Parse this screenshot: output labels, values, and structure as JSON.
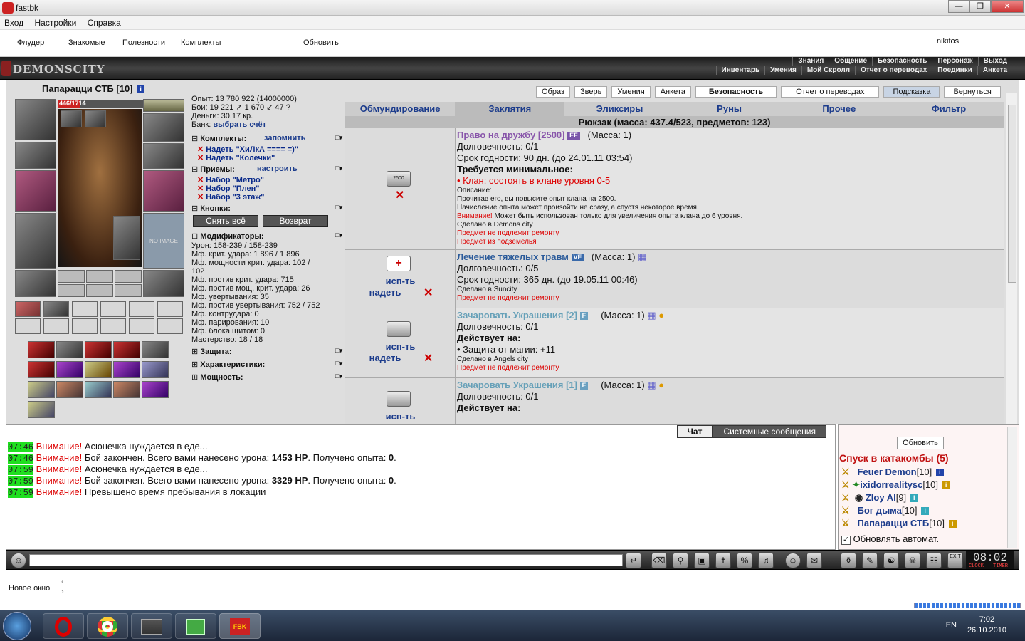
{
  "window": {
    "title": "fastbk",
    "min": "—",
    "max": "❐",
    "close": "✕"
  },
  "menu": [
    "Вход",
    "Настройки",
    "Справка"
  ],
  "toolbar": {
    "items": [
      "Флудер",
      "Знакомые",
      "Полезности",
      "Комплекты",
      "Обновить"
    ],
    "user": "nikitos"
  },
  "game": {
    "logo": "DEMONSCITY",
    "topnav1": [
      "Знания",
      "Общение",
      "Безопасность",
      "Персонаж",
      "Выход"
    ],
    "topnav2": [
      "Инвентарь",
      "Умения",
      "Мой Скролл",
      "Отчет о переводах",
      "Поединки",
      "Анкета"
    ]
  },
  "character": {
    "name": "Папарацци СТБ",
    "level": "[10]",
    "hp": "446/1714",
    "hp_fraction": 0.26,
    "no_image": "NO IMAGE"
  },
  "stats": {
    "exp": "Опыт: 13 780 922 (14000000)",
    "fights": "Бои: 19 221 ↗ 1 670 ↙ 47 ?",
    "money": "Деньги: 30.17 кр.",
    "bank_label": "Банк:",
    "bank_link": "выбрать счёт"
  },
  "sections": {
    "sets": {
      "title": "Комплекты:",
      "link": "запомнить",
      "items": [
        "Надеть \"ХиЛкА ==== =)\"",
        "Надеть \"Колечки\""
      ]
    },
    "moves": {
      "title": "Приемы:",
      "link": "настроить",
      "items": [
        "Набор \"Метро\"",
        "Набор \"Плен\"",
        "Набор \"3 этаж\""
      ]
    },
    "buttons": {
      "title": "Кнопки:",
      "remove_all": "Снять всё",
      "return": "Возврат"
    },
    "mods": {
      "title": "Модификаторы:",
      "lines": [
        "Урон: 158-239 / 158-239",
        "Мф. крит. удара: 1 896 / 1 896",
        "Мф. мощности крит. удара: 102 /",
        "102",
        "Мф. против крит. удара: 715",
        "Мф. против мощ. крит. удара: 26",
        "Мф. увертывания: 35",
        "Мф. против увертывания: 752 / 752",
        "Мф. контрудара: 0",
        "Мф. парирования: 10",
        "Мф. блока щитом: 0",
        "Мастерство: 18 / 18"
      ]
    },
    "protection": "Защита:",
    "characteristics": "Характеристики:",
    "powers": "Мощность:",
    "collapse": "□▾"
  },
  "toptabs": [
    "Образ",
    "Зверь",
    "Умения",
    "Анкета",
    "Безопасность",
    "Отчет о переводах",
    "Подсказка",
    "Вернуться"
  ],
  "categories": [
    "Обмундирование",
    "Заклятия",
    "Эликсиры",
    "Руны",
    "Прочее",
    "Фильтр"
  ],
  "bag_title": "Рюкзак (масса: 437.4/523, предметов: 123)",
  "items": [
    {
      "name": "Право на дружбу [2500]",
      "tag": "EF",
      "mass": "(Масса: 1)",
      "lines": [
        "Долговечность: 0/1",
        "Срок годности: 90 дн. (до 24.01.11 03:54)"
      ],
      "req_title": "Требуется минимальное:",
      "req": "• Клан: состоять в клане уровня 0-5",
      "desc_title": "Описание:",
      "desc1": "Прочитав его, вы повысите опыт клана на 2500.",
      "desc2": "Начисление опыта может произойти не сразу, а спустя некоторое время.",
      "warn_label": "Внимание!",
      "warn_text": " Может быть использован только для увеличения опыта клана до 6 уровня.",
      "made": "Сделано в Demons city",
      "note1": "Предмет не подлежит ремонту",
      "note2": "Предмет из подземелья",
      "icon_label": "2500"
    },
    {
      "name": "Лечение тяжелых травм",
      "tag": "VF",
      "mass": "(Масса: 1)",
      "lines": [
        "Долговечность: 0/5",
        "Срок годности: 365 дн. (до 19.05.11 00:46)"
      ],
      "made": "Сделано в Suncity",
      "note1": "Предмет не подлежит ремонту",
      "act1": "исп-ть",
      "act2": "надеть"
    },
    {
      "name": "Зачаровать Украшения [2]",
      "tag": "F",
      "mass": "(Масса: 1)",
      "lines": [
        "Долговечность: 0/1"
      ],
      "effect_title": "Действует на:",
      "effect": "• Защита от магии: +11",
      "made": "Сделано в Angels city",
      "note1": "Предмет не подлежит ремонту",
      "act1": "исп-ть",
      "act2": "надеть"
    },
    {
      "name": "Зачаровать Украшения [1]",
      "tag": "F",
      "mass": "(Масса: 1)",
      "lines": [
        "Долговечность: 0/1"
      ],
      "effect_title": "Действует на:",
      "act1": "исп-ть"
    }
  ],
  "chat": {
    "tabs": [
      "Чат",
      "Системные сообщения"
    ],
    "messages": [
      {
        "time": "07:46",
        "warn": "Внимание!",
        "text": "Асюнечка нуждается в еде..."
      },
      {
        "time": "07:46",
        "warn": "Внимание!",
        "pre": "Бой закончен. Всего вами нанесено урона: ",
        "b1": "1453 HP",
        "mid": ". Получено опыта: ",
        "b2": "0",
        "post": "."
      },
      {
        "time": "07:59",
        "warn": "Внимание!",
        "text": "Асюнечка нуждается в еде..."
      },
      {
        "time": "07:59",
        "warn": "Внимание!",
        "pre": "Бой закончен. Всего вами нанесено урона: ",
        "b1": "3329 HP",
        "mid": ". Получено опыта: ",
        "b2": "0",
        "post": "."
      },
      {
        "time": "07:59",
        "warn": "Внимание!",
        "text": "Превышено время пребывания в локации"
      }
    ]
  },
  "online": {
    "refresh": "Обновить",
    "location": "Спуск в катакомбы (5)",
    "users": [
      {
        "name": "Feuer Demon",
        "level": "[10]"
      },
      {
        "name": "ixidorrealitysc",
        "level": "[10]"
      },
      {
        "name": "Zloy Al",
        "level": "[9]"
      },
      {
        "name": "Бог дыма",
        "level": "[10]"
      },
      {
        "name": "Папарацци СТБ",
        "level": "[10]"
      }
    ],
    "autorefresh": "Обновлять автомат."
  },
  "clock": {
    "time": "08:02",
    "label": "CLOCK",
    "timer": "TIMER",
    "exit": "EXIT"
  },
  "newwin": "Новое окно",
  "tray": {
    "lang": "EN",
    "time": "7:02",
    "date": "26.10.2010"
  },
  "colors": {
    "accent": "#1c3c8c",
    "warn": "#d00000",
    "timestamp_bg": "#1fdf1f"
  }
}
